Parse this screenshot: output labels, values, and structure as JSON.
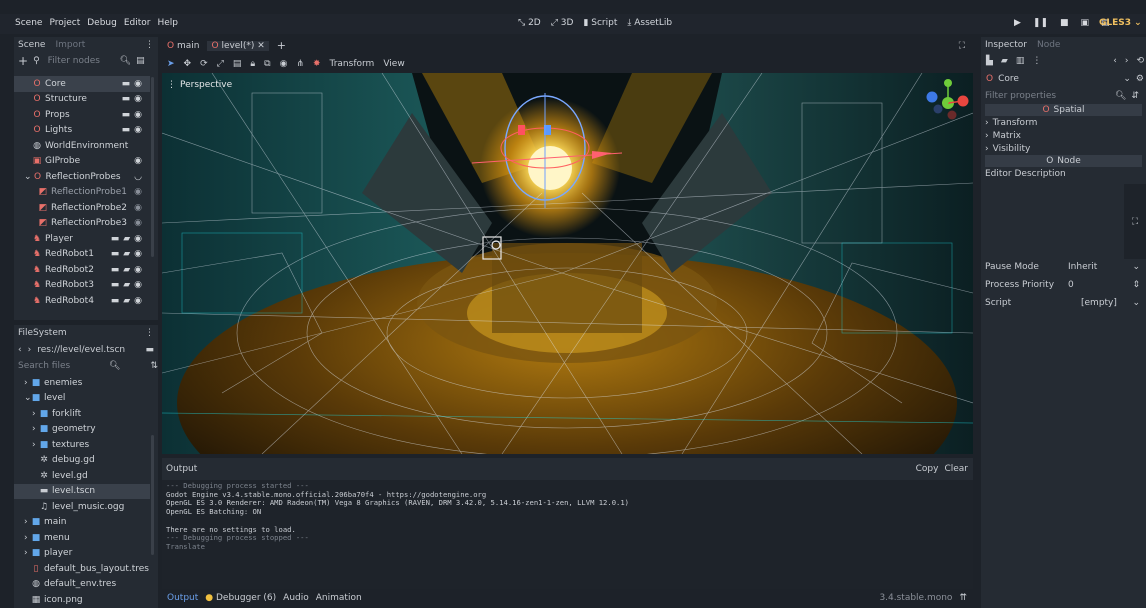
{
  "menu": [
    "Scene",
    "Project",
    "Debug",
    "Editor",
    "Help"
  ],
  "modes": [
    {
      "icon": "2d-icon",
      "label": "2D"
    },
    {
      "icon": "3d-icon",
      "label": "3D"
    },
    {
      "icon": "script-icon",
      "label": "Script"
    },
    {
      "icon": "assetlib-icon",
      "label": "AssetLib"
    }
  ],
  "renderer": "GLES3",
  "scene_dock": {
    "tabs": [
      "Scene",
      "Import"
    ],
    "filter_placeholder": "Filter nodes",
    "nodes": [
      {
        "label": "Core",
        "indent": 1,
        "icon": "spatial",
        "selected": true,
        "right": [
          "film",
          "eye"
        ]
      },
      {
        "label": "Structure",
        "indent": 1,
        "icon": "spatial",
        "right": [
          "film",
          "eye"
        ]
      },
      {
        "label": "Props",
        "indent": 1,
        "icon": "spatial",
        "right": [
          "film",
          "eye"
        ]
      },
      {
        "label": "Lights",
        "indent": 1,
        "icon": "spatial",
        "right": [
          "film",
          "eye"
        ]
      },
      {
        "label": "WorldEnvironment",
        "indent": 1,
        "icon": "world",
        "right": []
      },
      {
        "label": "GIProbe",
        "indent": 1,
        "icon": "gi",
        "right": [
          "eye"
        ]
      },
      {
        "label": "ReflectionProbes",
        "indent": 0,
        "icon": "spatial",
        "expand": true,
        "right": [
          "eye-closed"
        ]
      },
      {
        "label": "ReflectionProbe1",
        "indent": 2,
        "icon": "probe",
        "dim": true,
        "right": [
          "eye-dim"
        ]
      },
      {
        "label": "ReflectionProbe2",
        "indent": 2,
        "icon": "probe",
        "right": [
          "eye-dim"
        ]
      },
      {
        "label": "ReflectionProbe3",
        "indent": 2,
        "icon": "probe",
        "right": [
          "eye-dim"
        ]
      },
      {
        "label": "Player",
        "indent": 1,
        "icon": "robot",
        "right": [
          "film",
          "script",
          "eye"
        ]
      },
      {
        "label": "RedRobot1",
        "indent": 1,
        "icon": "robot",
        "right": [
          "film",
          "script",
          "eye"
        ]
      },
      {
        "label": "RedRobot2",
        "indent": 1,
        "icon": "robot",
        "right": [
          "film",
          "script",
          "eye"
        ]
      },
      {
        "label": "RedRobot3",
        "indent": 1,
        "icon": "robot",
        "right": [
          "film",
          "script",
          "eye"
        ]
      },
      {
        "label": "RedRobot4",
        "indent": 1,
        "icon": "robot",
        "right": [
          "film",
          "script",
          "eye"
        ]
      }
    ]
  },
  "filesystem": {
    "title": "FileSystem",
    "path": "res://level/evel.tscn",
    "search_placeholder": "Search files",
    "items": [
      {
        "label": "enemies",
        "type": "folder",
        "indent": 1,
        "arrow": ">"
      },
      {
        "label": "level",
        "type": "folder",
        "indent": 1,
        "arrow": "v"
      },
      {
        "label": "forklift",
        "type": "folder",
        "indent": 2,
        "arrow": ">"
      },
      {
        "label": "geometry",
        "type": "folder",
        "indent": 2,
        "arrow": ">"
      },
      {
        "label": "textures",
        "type": "folder",
        "indent": 2,
        "arrow": ">"
      },
      {
        "label": "debug.gd",
        "type": "gear",
        "indent": 2
      },
      {
        "label": "level.gd",
        "type": "gear",
        "indent": 2
      },
      {
        "label": "level.tscn",
        "type": "scene",
        "indent": 2,
        "selected": true
      },
      {
        "label": "level_music.ogg",
        "type": "audio",
        "indent": 2
      },
      {
        "label": "main",
        "type": "folder",
        "indent": 1,
        "arrow": ">"
      },
      {
        "label": "menu",
        "type": "folder",
        "indent": 1,
        "arrow": ">"
      },
      {
        "label": "player",
        "type": "folder",
        "indent": 1,
        "arrow": ">"
      },
      {
        "label": "default_bus_layout.tres",
        "type": "bus",
        "indent": 1
      },
      {
        "label": "default_env.tres",
        "type": "env",
        "indent": 1
      },
      {
        "label": "icon.png",
        "type": "image",
        "indent": 1
      }
    ]
  },
  "editor_tabs": [
    {
      "label": "main",
      "active": false
    },
    {
      "label": "level(*)",
      "active": true
    }
  ],
  "toolbar": {
    "transform": "Transform",
    "view": "View"
  },
  "viewport": {
    "label": "Perspective"
  },
  "output": {
    "title": "Output",
    "copy": "Copy",
    "clear": "Clear",
    "lines": [
      {
        "text": "--- Debugging process started ---",
        "dim": true
      },
      {
        "text": "Godot Engine v3.4.stable.mono.official.206ba70f4 - https://godotengine.org",
        "dim": false
      },
      {
        "text": "OpenGL ES 3.0 Renderer: AMD Radeon(TM) Vega 8 Graphics (RAVEN, DRM 3.42.0, 5.14.16-zen1-1-zen, LLVM 12.0.1)",
        "dim": false
      },
      {
        "text": "OpenGL ES Batching: ON",
        "dim": false
      },
      {
        "text": "",
        "dim": false
      },
      {
        "text": "There are no settings to load.",
        "dim": false
      },
      {
        "text": "--- Debugging process stopped ---",
        "dim": true
      },
      {
        "text": "Translate",
        "dim": true
      }
    ]
  },
  "bottom_tabs": [
    {
      "label": "Output",
      "active": true
    },
    {
      "label": "Debugger (6)",
      "badge": true
    },
    {
      "label": "Audio"
    },
    {
      "label": "Animation"
    }
  ],
  "version": "3.4.stable.mono",
  "inspector": {
    "tabs": [
      "Inspector",
      "Node"
    ],
    "node_name": "Core",
    "filter_placeholder": "Filter properties",
    "sections": {
      "spatial": "Spatial",
      "node": "Node"
    },
    "groups": [
      "Transform",
      "Matrix",
      "Visibility"
    ],
    "editor_description": "Editor Description",
    "props": [
      {
        "label": "Pause Mode",
        "value": "Inherit",
        "ctrl": "chevron"
      },
      {
        "label": "Process Priority",
        "value": "0",
        "ctrl": "spin"
      },
      {
        "label": "Script",
        "value": "[empty]",
        "ctrl": "chevron"
      }
    ]
  }
}
